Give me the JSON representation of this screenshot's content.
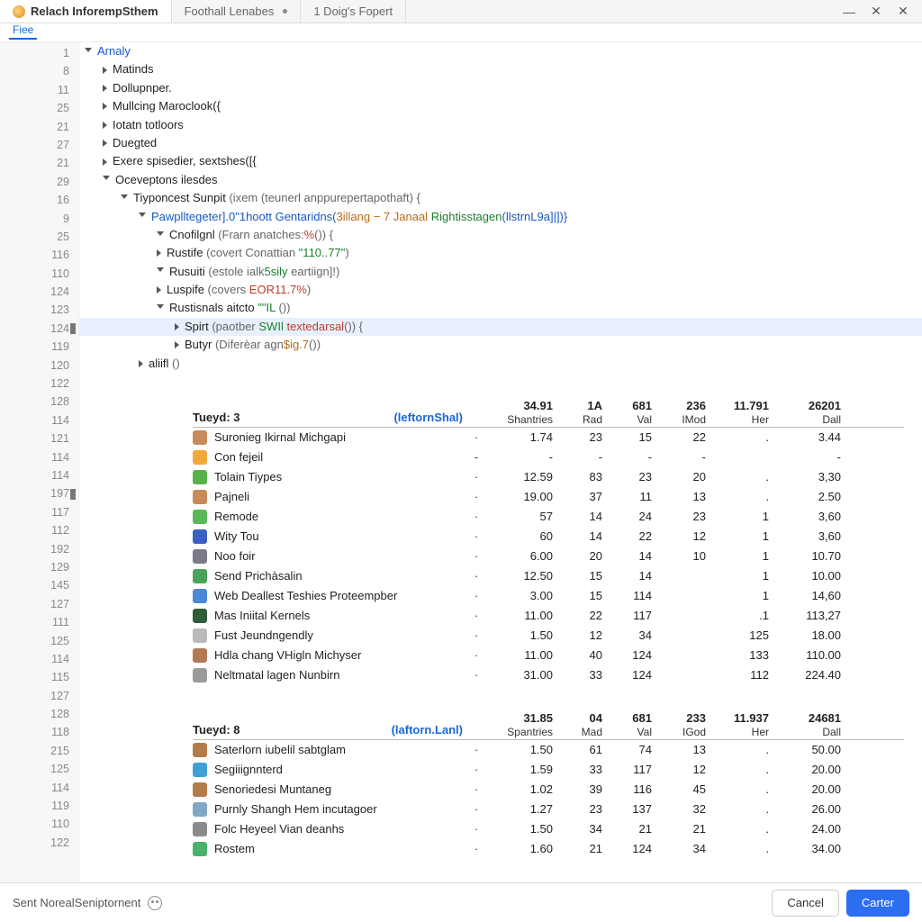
{
  "tabs": [
    {
      "label": "Relach InforempSthem"
    },
    {
      "label": "Foothall Lenabes"
    },
    {
      "label": "1 Doig's Fopert"
    }
  ],
  "toolbar": {
    "file": "Fiee"
  },
  "gutter_lines": [
    "1",
    "8",
    "11",
    "25",
    "21",
    "27",
    "21",
    "29",
    "16",
    "9",
    "25",
    "116",
    "110",
    "124",
    "123",
    "124",
    "119",
    "120",
    "122",
    "128",
    "114",
    "121",
    "114",
    "114",
    "197",
    "117",
    "112",
    "192",
    "129",
    "145",
    "127",
    "111",
    "125",
    "114",
    "115",
    "127",
    "128",
    "118",
    "215",
    "125",
    "114",
    "119",
    "110",
    "122"
  ],
  "tree": [
    {
      "i": 0,
      "open": true,
      "blue": true,
      "text": "Arnaly"
    },
    {
      "i": 1,
      "open": false,
      "text": "Matinds"
    },
    {
      "i": 1,
      "open": false,
      "text": "Dollupnper."
    },
    {
      "i": 1,
      "open": false,
      "text": "Mullcing Maroclook({"
    },
    {
      "i": 1,
      "open": false,
      "text": "Iotatn totloors"
    },
    {
      "i": 1,
      "open": false,
      "text": "Duegted"
    },
    {
      "i": 1,
      "open": false,
      "text": "Exere spisedier, sextshes([{"
    },
    {
      "i": 1,
      "open": true,
      "text": "Oceveptons ilesdes"
    },
    {
      "i": 2,
      "open": true,
      "html": "Tiyponcest Sunpit <span class='gray'>(ixem (teunerl anppurepertapothaft) {</span>"
    },
    {
      "i": 3,
      "open": true,
      "html": "<span class='blue'>Pawplltegeter].0\"1hoott Gentaridns(</span><span class='orange'>3illang − 7 Janaal</span> <span class='green'>Rightisstagen</span><span class='blue'>(llstrnL9a]|])}</span>"
    },
    {
      "i": 4,
      "open": true,
      "html": "Cnofilgnl <span class='gray'>(Frarn anatches:</span><span class='red'>%</span><span class='gray'>()) {</span>"
    },
    {
      "i": 4,
      "open": false,
      "html": "Rustife <span class='gray'>(covert Conattian </span><span class='green'>\"110..77\"</span><span class='gray'>)</span>"
    },
    {
      "i": 4,
      "open": true,
      "html": "Rusuiti <span class='gray'>(estole ialk</span><span class='green'>5sily</span><span class='gray'> eartiign]!)</span>"
    },
    {
      "i": 4,
      "open": false,
      "html": "Luspife <span class='gray'>(covers </span><span class='red'>EOR11.7%</span><span class='gray'>)</span>"
    },
    {
      "i": 4,
      "open": true,
      "html": "Rustisnals aitcto <span class='green'>\"\"IL</span> <span class='gray'>())</span>"
    },
    {
      "i": 5,
      "open": false,
      "hl": true,
      "html": "Spirt <span class='gray'>(paotber </span><span class='green'>SWIl</span> <span class='red'>textedarsal</span><span class='gray'>()) {</span>"
    },
    {
      "i": 5,
      "open": false,
      "html": "Butyr <span class='gray'>(Diferèar agn</span><span class='orange'>$ig.7</span><span class='gray'>())</span>"
    },
    {
      "i": 3,
      "open": false,
      "html": "aliifl <span class='gray'>()</span>"
    }
  ],
  "table1": {
    "label": "Tueyd: 3",
    "link": "(leftornShal)",
    "headers": [
      {
        "n": "34.91",
        "s": "Shantries"
      },
      {
        "n": "1A",
        "s": "Rad"
      },
      {
        "n": "681",
        "s": "Val"
      },
      {
        "n": "236",
        "s": "IMod"
      },
      {
        "n": "11.791",
        "s": "Her"
      },
      {
        "n": "26201",
        "s": "Dall"
      }
    ],
    "rows": [
      {
        "ic": "#c78b5a",
        "nm": "Suronieg Ikirnal Michgapi",
        "d": "·",
        "v": [
          "1.74",
          "23",
          "15",
          "22",
          ".",
          "3.44"
        ]
      },
      {
        "ic": "#f2a93b",
        "nm": "Con fejeil",
        "d": "-",
        "v": [
          "-",
          "-",
          "-",
          "-",
          "",
          "-"
        ]
      },
      {
        "ic": "#57b24b",
        "nm": "Tolain Tiypes",
        "d": "·",
        "v": [
          "12.59",
          "83",
          "23",
          "20",
          ".",
          "3,30"
        ]
      },
      {
        "ic": "#c78b5a",
        "nm": "Pajneli",
        "d": "·",
        "v": [
          "19.00",
          "37",
          "11",
          "13",
          ".",
          "2.50"
        ]
      },
      {
        "ic": "#5ab85a",
        "nm": "Remode",
        "d": "·",
        "v": [
          "57",
          "14",
          "24",
          "23",
          "1",
          "3,60"
        ]
      },
      {
        "ic": "#3a5fc4",
        "nm": "Wity Tou",
        "d": "·",
        "v": [
          "60",
          "14",
          "22",
          "12",
          "1",
          "3,60"
        ]
      },
      {
        "ic": "#7a7a8a",
        "nm": "Noo foir",
        "d": "·",
        "v": [
          "6.00",
          "20",
          "14",
          "10",
          "1",
          "10.70"
        ]
      },
      {
        "ic": "#4aa35a",
        "nm": "Send Prichàsalin",
        "d": "·",
        "v": [
          "12.50",
          "15",
          "14",
          "",
          "1",
          "10.00"
        ]
      },
      {
        "ic": "#4c88d6",
        "nm": "Web Deallest Teshies Proteempber",
        "d": "·",
        "v": [
          "3.00",
          "15",
          "114",
          "",
          "1",
          "14,60"
        ]
      },
      {
        "ic": "#2f5d3a",
        "nm": "Mas Iniital Kernels",
        "d": "·",
        "v": [
          "11.00",
          "22",
          "117",
          "",
          ".1",
          "113,27"
        ]
      },
      {
        "ic": "#bababa",
        "nm": "Fust Jeundngendly",
        "d": "·",
        "v": [
          "1.50",
          "12",
          "34",
          "",
          "125",
          "18.00"
        ]
      },
      {
        "ic": "#b07a55",
        "nm": "Hdla chang VHigln Michyser",
        "d": "·",
        "v": [
          "11.00",
          "40",
          "124",
          "",
          "133",
          "110.00"
        ]
      },
      {
        "ic": "#9a9a9a",
        "nm": "Neltmatal lagen Nunbirn",
        "d": "·",
        "v": [
          "31.00",
          "33",
          "124",
          "",
          "112",
          "224.40"
        ]
      }
    ]
  },
  "table2": {
    "label": "Tueyd: 8",
    "link": "(laftorn.Lanl)",
    "headers": [
      {
        "n": "31.85",
        "s": "Spantries"
      },
      {
        "n": "04",
        "s": "Mad"
      },
      {
        "n": "681",
        "s": "Val"
      },
      {
        "n": "233",
        "s": "IGod"
      },
      {
        "n": "11.937",
        "s": "Her"
      },
      {
        "n": "24681",
        "s": "Dall"
      }
    ],
    "rows": [
      {
        "ic": "#b57a4a",
        "nm": "Saterlorn iubelil sabtglam",
        "d": "·",
        "v": [
          "1.50",
          "61",
          "74",
          "13",
          ".",
          "50.00"
        ]
      },
      {
        "ic": "#3fa0d6",
        "nm": "Segiiignnterd",
        "d": "·",
        "v": [
          "1.59",
          "33",
          "117",
          "12",
          ".",
          "20.00"
        ]
      },
      {
        "ic": "#b57a4a",
        "nm": "Senoriedesi Muntaneg",
        "d": "·",
        "v": [
          "1.02",
          "39",
          "116",
          "45",
          ".",
          "20.00"
        ]
      },
      {
        "ic": "#7fa8c4",
        "nm": "Purnly Shangh Hem incutagoer",
        "d": "·",
        "v": [
          "1.27",
          "23",
          "137",
          "32",
          ".",
          "26.00"
        ]
      },
      {
        "ic": "#8a8a8a",
        "nm": "Folc Heyeel Vian deanhs",
        "d": "·",
        "v": [
          "1.50",
          "34",
          "21",
          "21",
          ".",
          "24.00"
        ]
      },
      {
        "ic": "#48b26a",
        "nm": "Rostem",
        "d": "·",
        "v": [
          "1.60",
          "21",
          "124",
          "34",
          ".",
          "34.00"
        ]
      }
    ]
  },
  "status": {
    "text": "Sent NorealSeniptornent"
  },
  "buttons": {
    "cancel": "Cancel",
    "primary": "Carter"
  }
}
